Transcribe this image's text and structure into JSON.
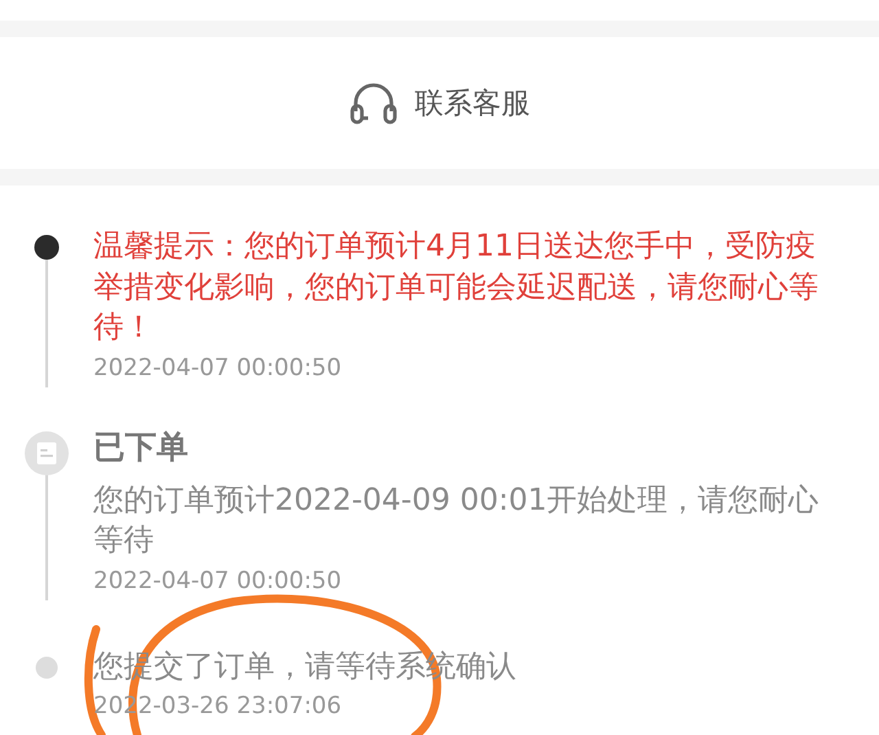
{
  "contact": {
    "label": "联系客服"
  },
  "timeline": [
    {
      "kind": "notice",
      "text": "温馨提示：您的订单预计4月11日送达您手中，受防疫举措变化影响，您的订单可能会延迟配送，请您耐心等待！",
      "time": "2022-04-07 00:00:50"
    },
    {
      "kind": "status",
      "title": "已下单",
      "text": "您的订单预计2022-04-09 00:01开始处理，请您耐心等待",
      "time": "2022-04-07 00:00:50"
    },
    {
      "kind": "event",
      "text": "您提交了订单，请等待系统确认",
      "time": "2022-03-26 23:07:06"
    }
  ]
}
